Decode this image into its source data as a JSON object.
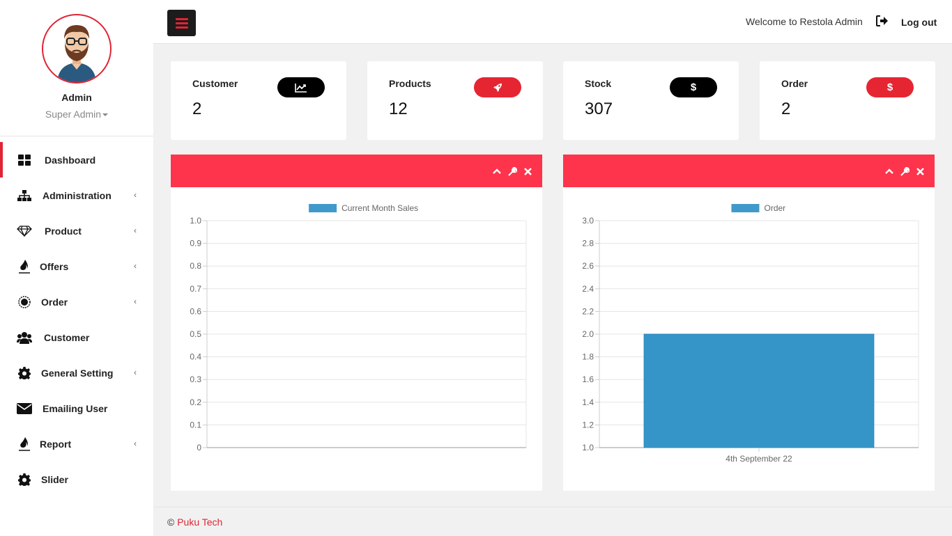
{
  "profile": {
    "name": "Admin",
    "role": "Super Admin"
  },
  "sidebar": {
    "items": [
      {
        "label": "Dashboard",
        "icon": "dashboard-icon",
        "active": true,
        "has_submenu": false
      },
      {
        "label": "Administration",
        "icon": "sitemap-icon",
        "has_submenu": true
      },
      {
        "label": "Product",
        "icon": "diamond-icon",
        "has_submenu": true
      },
      {
        "label": "Offers",
        "icon": "fire-icon",
        "has_submenu": true
      },
      {
        "label": "Order",
        "icon": "spinner-icon",
        "has_submenu": true
      },
      {
        "label": "Customer",
        "icon": "users-icon",
        "has_submenu": false
      },
      {
        "label": "General Setting",
        "icon": "gear-icon",
        "has_submenu": true
      },
      {
        "label": "Emailing User",
        "icon": "envelope-icon",
        "has_submenu": false
      },
      {
        "label": "Report",
        "icon": "fire-icon",
        "has_submenu": true
      },
      {
        "label": "Slider",
        "icon": "gear-icon",
        "has_submenu": false
      }
    ],
    "chevron": "‹"
  },
  "topbar": {
    "welcome": "Welcome to Restola Admin",
    "logout": "Log out"
  },
  "cards": [
    {
      "title": "Customer",
      "value": "2",
      "icon": "chart-line-icon",
      "pill_color": "#000000"
    },
    {
      "title": "Products",
      "value": "12",
      "icon": "rocket-icon",
      "pill_color": "#e62533"
    },
    {
      "title": "Stock",
      "value": "307",
      "icon": "dollar-icon",
      "pill_color": "#000000"
    },
    {
      "title": "Order",
      "value": "2",
      "icon": "dollar-icon",
      "pill_color": "#e62533"
    }
  ],
  "colors": {
    "accent": "#e02434",
    "panel_header": "#fe334c",
    "bar": "#3595c8"
  },
  "chart_data": [
    {
      "type": "bar",
      "series": [
        {
          "name": "Current Month Sales",
          "values": []
        }
      ],
      "categories": [],
      "ylim": [
        0,
        1.0
      ],
      "yticks": [
        "1.0",
        "0.9",
        "0.8",
        "0.7",
        "0.6",
        "0.5",
        "0.4",
        "0.3",
        "0.2",
        "0.1",
        "0"
      ],
      "grid": true,
      "legend": "top"
    },
    {
      "type": "bar",
      "series": [
        {
          "name": "Order",
          "values": [
            2
          ]
        }
      ],
      "categories": [
        "4th September 22"
      ],
      "ylim": [
        1.0,
        3.0
      ],
      "yticks": [
        "3.0",
        "2.8",
        "2.6",
        "2.4",
        "2.2",
        "2.0",
        "1.8",
        "1.6",
        "1.4",
        "1.2",
        "1.0"
      ],
      "grid": true,
      "legend": "top"
    }
  ],
  "footer": {
    "copyright": "©",
    "company": "Puku Tech"
  }
}
